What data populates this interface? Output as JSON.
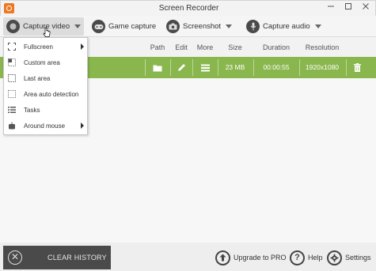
{
  "window": {
    "title": "Screen Recorder",
    "minimize_icon": "minimize-icon",
    "maximize_icon": "maximize-icon",
    "close_icon": "close-icon"
  },
  "toolbar": {
    "capture_video": "Capture video",
    "game_capture": "Game capture",
    "screenshot": "Screenshot",
    "capture_audio": "Capture audio"
  },
  "table": {
    "headers": [
      "Path",
      "Edit",
      "More",
      "Size",
      "Duration",
      "Resolution"
    ],
    "rows": [
      {
        "size": "23 MB",
        "duration": "00:00:55",
        "resolution": "1920x1080"
      }
    ]
  },
  "capture_menu": {
    "items": [
      {
        "label": "Fullscreen",
        "icon": "fullscreen-icon",
        "submenu": true
      },
      {
        "label": "Custom area",
        "icon": "custom-area-icon",
        "submenu": false
      },
      {
        "label": "Last area",
        "icon": "last-area-icon",
        "submenu": false
      },
      {
        "label": "Area auto detection",
        "icon": "area-auto-detection-icon",
        "submenu": false
      },
      {
        "label": "Tasks",
        "icon": "tasks-icon",
        "submenu": false
      },
      {
        "label": "Around mouse",
        "icon": "around-mouse-icon",
        "submenu": true
      }
    ]
  },
  "bottom": {
    "clear_history": "CLEAR HISTORY",
    "upgrade": "Upgrade to PRO",
    "help": "Help",
    "settings": "Settings"
  },
  "colors": {
    "row_highlight": "#8ab64e",
    "clear_button_bg": "#4a4a4a",
    "app_icon": "#ee7722"
  }
}
